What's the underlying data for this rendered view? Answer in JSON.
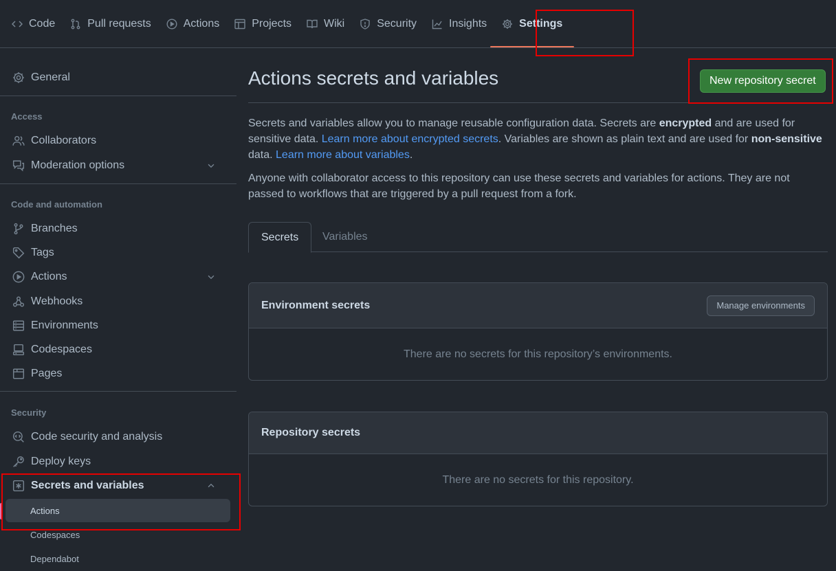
{
  "topnav": {
    "tabs": [
      {
        "label": "Code",
        "icon": "code-icon"
      },
      {
        "label": "Pull requests",
        "icon": "git-pull-request-icon"
      },
      {
        "label": "Actions",
        "icon": "play-icon"
      },
      {
        "label": "Projects",
        "icon": "table-icon"
      },
      {
        "label": "Wiki",
        "icon": "book-icon"
      },
      {
        "label": "Security",
        "icon": "shield-icon"
      },
      {
        "label": "Insights",
        "icon": "graph-icon"
      },
      {
        "label": "Settings",
        "icon": "gear-icon",
        "selected": true
      }
    ]
  },
  "sidebar": {
    "general": "General",
    "access_heading": "Access",
    "access_items": [
      "Collaborators",
      "Moderation options"
    ],
    "code_heading": "Code and automation",
    "code_items": [
      "Branches",
      "Tags",
      "Actions",
      "Webhooks",
      "Environments",
      "Codespaces",
      "Pages"
    ],
    "security_heading": "Security",
    "security_items": [
      "Code security and analysis",
      "Deploy keys",
      "Secrets and variables"
    ],
    "secrets_sub_items": [
      "Actions",
      "Codespaces",
      "Dependabot"
    ],
    "active_sub_item": "Actions"
  },
  "main": {
    "title": "Actions secrets and variables",
    "new_secret_button": "New repository secret",
    "intro": {
      "p1_a": "Secrets and variables allow you to manage reusable configuration data. Secrets are ",
      "p1_b": "encrypted",
      "p1_c": " and are used for sensitive data. ",
      "link_secrets": "Learn more about encrypted secrets",
      "p1_d": ". Variables are shown as plain text and are used for ",
      "p1_e": "non-sensitive",
      "p1_f": " data. ",
      "link_variables": "Learn more about variables",
      "p1_g": ".",
      "p2": "Anyone with collaborator access to this repository can use these secrets and variables for actions. They are not passed to workflows that are triggered by a pull request from a fork."
    },
    "tabs": [
      "Secrets",
      "Variables"
    ],
    "environment_box": {
      "title": "Environment secrets",
      "button": "Manage environments",
      "empty": "There are no secrets for this repository’s environments."
    },
    "repository_box": {
      "title": "Repository secrets",
      "empty": "There are no secrets for this repository."
    }
  },
  "colors": {
    "background": "#22272e",
    "primary_button": "#347d39",
    "link": "#539bf5",
    "selected_underline": "#ec775c",
    "annotation_red": "#e60000"
  }
}
